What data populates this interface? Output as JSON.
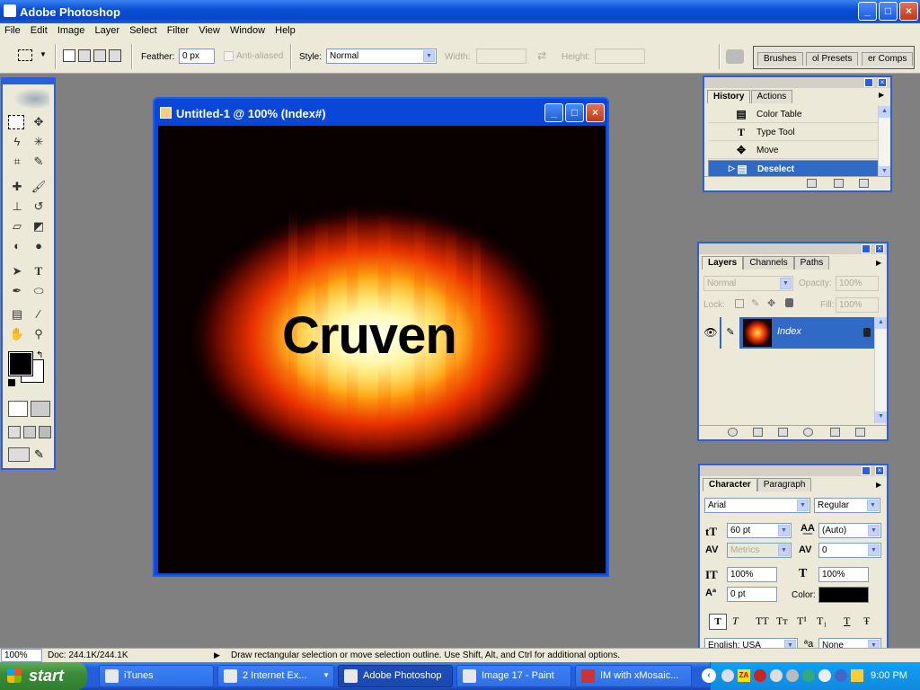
{
  "app": {
    "title": "Adobe Photoshop",
    "window_controls": [
      "_",
      "□",
      "×"
    ]
  },
  "menu": [
    "File",
    "Edit",
    "Image",
    "Layer",
    "Select",
    "Filter",
    "View",
    "Window",
    "Help"
  ],
  "options": {
    "feather_label": "Feather:",
    "feather_value": "0 px",
    "antialiased_label": "Anti-aliased",
    "style_label": "Style:",
    "style_value": "Normal",
    "width_label": "Width:",
    "height_label": "Height:",
    "palette_tabs": [
      "Brushes",
      "ol Presets",
      "er Comps"
    ]
  },
  "document": {
    "title": "Untitled-1 @ 100% (Index#)",
    "canvas_text": "Cruven"
  },
  "history_panel": {
    "tabs": [
      "History",
      "Actions"
    ],
    "items": [
      {
        "icon": "table-icon",
        "label": "Color Table"
      },
      {
        "icon": "type-tool-icon",
        "label": "Type Tool"
      },
      {
        "icon": "move-tool-icon",
        "label": "Move"
      },
      {
        "icon": "table-icon",
        "label": "Deselect"
      }
    ],
    "selected": "Deselect"
  },
  "layers_panel": {
    "tabs": [
      "Layers",
      "Channels",
      "Paths"
    ],
    "blend_mode": "Normal",
    "opacity_label": "Opacity:",
    "opacity": "100%",
    "lock_label": "Lock:",
    "fill_label": "Fill:",
    "fill": "100%",
    "layer_name": "Index"
  },
  "character_panel": {
    "tabs": [
      "Character",
      "Paragraph"
    ],
    "font": "Arial",
    "style": "Regular",
    "size": "60 pt",
    "leading": "(Auto)",
    "kerning": "Metrics",
    "tracking": "0",
    "vertical_scale": "100%",
    "horizontal_scale": "100%",
    "baseline": "0 pt",
    "color_label": "Color:",
    "text_color": "#000000",
    "language": "English: USA",
    "antialias_label": "a",
    "antialias": "None",
    "style_buttons": [
      "T",
      "T",
      "TT",
      "Tт",
      "T¹",
      "T₁",
      "T",
      "Ŧ"
    ]
  },
  "status": {
    "zoom": "100%",
    "doc": "Doc: 244.1K/244.1K",
    "hint": "Draw rectangular selection or move selection outline.  Use Shift, Alt, and Ctrl for additional options."
  },
  "taskbar": {
    "start_label": "start",
    "buttons": [
      {
        "label": "iTunes",
        "active": false
      },
      {
        "label": "2 Internet Ex...",
        "active": false
      },
      {
        "label": "Adobe Photoshop",
        "active": true
      },
      {
        "label": "Image 17 - Paint",
        "active": false
      },
      {
        "label": "IM with xMosaic...",
        "active": false
      }
    ],
    "tray_lang": "ZA",
    "clock": "9:00 PM"
  },
  "colors": {
    "xp_blue": "#0a4fd6",
    "panel_bg": "#ece9d8",
    "selection": "#316ac5",
    "foreground": "#000000",
    "background": "#ffffff"
  }
}
